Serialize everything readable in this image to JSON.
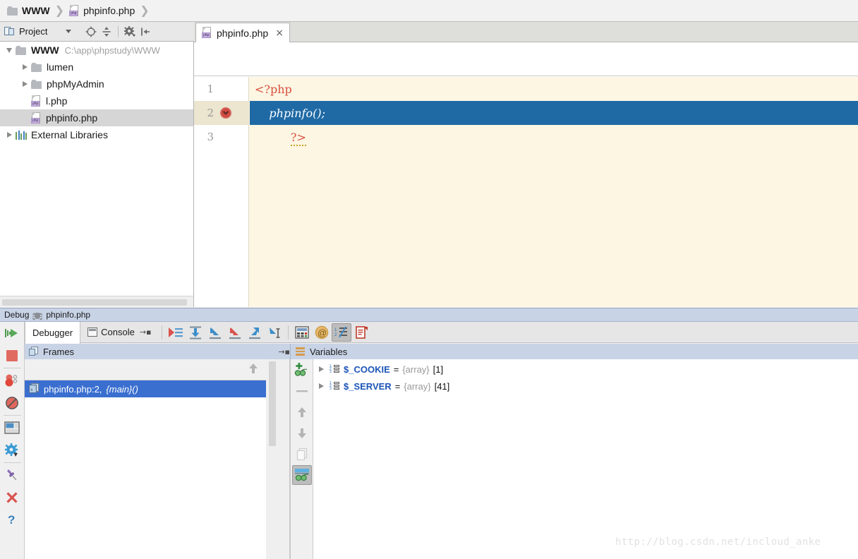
{
  "breadcrumb": {
    "items": [
      {
        "label": "WWW",
        "icon": "folder-icon"
      },
      {
        "label": "phpinfo.php",
        "icon": "php-file-icon"
      }
    ],
    "separator": "❯"
  },
  "project_toolbar": {
    "title": "Project",
    "icons": [
      "locate-target-icon",
      "collapse-all-icon",
      "settings-gear-icon",
      "hide-panel-icon"
    ]
  },
  "editor_tabs": {
    "tabs": [
      {
        "label": "phpinfo.php",
        "icon": "php-file-icon",
        "close": "×",
        "active": true
      }
    ]
  },
  "project_tree": {
    "rows": [
      {
        "label": "WWW",
        "path": "C:\\app\\phpstudy\\WWW",
        "icon": "folder-icon",
        "twisty": "down",
        "bold": true,
        "indent": 0,
        "selected": false
      },
      {
        "label": "lumen",
        "path": "",
        "icon": "folder-icon",
        "twisty": "right",
        "bold": false,
        "indent": 1,
        "selected": false
      },
      {
        "label": "phpMyAdmin",
        "path": "",
        "icon": "folder-icon",
        "twisty": "right",
        "bold": false,
        "indent": 1,
        "selected": false
      },
      {
        "label": "l.php",
        "path": "",
        "icon": "php-file-icon",
        "twisty": "none",
        "bold": false,
        "indent": 1,
        "selected": false
      },
      {
        "label": "phpinfo.php",
        "path": "",
        "icon": "php-file-icon",
        "twisty": "none",
        "bold": false,
        "indent": 1,
        "selected": true
      },
      {
        "label": "External Libraries",
        "path": "",
        "icon": "libraries-icon",
        "twisty": "right",
        "bold": false,
        "indent": 0,
        "selected": false
      }
    ]
  },
  "editor": {
    "language": "php",
    "background_color": "#fcf6e3",
    "current_line_color": "#1f6aa5",
    "lines": [
      {
        "number": "1",
        "text": "<?php",
        "token": "tag",
        "breakpoint": false,
        "current": false
      },
      {
        "number": "2",
        "text": "    phpinfo();",
        "token": "fn",
        "breakpoint": true,
        "current": true
      },
      {
        "number": "3",
        "text": "?>",
        "token": "end",
        "breakpoint": false,
        "current": false
      }
    ]
  },
  "debug": {
    "header_title": "Debug",
    "header_file": "phpinfo.php",
    "header_icon": "bug-icon",
    "left_rail": [
      {
        "name": "resume-program-button",
        "icon": "resume-icon"
      },
      {
        "name": "stop-button",
        "icon": "stop-icon"
      },
      {
        "name": "view-breakpoints-button",
        "icon": "breakpoints-icon"
      },
      {
        "name": "mute-breakpoints-button",
        "icon": "mute-breakpoints-icon"
      },
      {
        "name": "restore-layout-button",
        "icon": "layout-icon"
      },
      {
        "name": "settings-button",
        "icon": "gear-icon"
      },
      {
        "name": "pin-tab-button",
        "icon": "pin-icon"
      },
      {
        "name": "close-button",
        "icon": "close-icon"
      },
      {
        "name": "help-button",
        "icon": "help-icon"
      }
    ],
    "tabs": [
      {
        "label": "Debugger",
        "icon": "",
        "active": true
      },
      {
        "label": "Console",
        "icon": "console-icon",
        "active": false
      }
    ],
    "console_hide_glyph": "→▪",
    "step_buttons": [
      {
        "name": "show-execution-point-button",
        "icon": "show-execution-point-icon",
        "pressed": false
      },
      {
        "name": "step-over-button",
        "icon": "step-over-icon",
        "pressed": false
      },
      {
        "name": "step-into-button",
        "icon": "step-into-icon",
        "pressed": false
      },
      {
        "name": "force-step-into-button",
        "icon": "force-step-into-icon",
        "pressed": false
      },
      {
        "name": "step-out-button",
        "icon": "step-out-icon",
        "pressed": false
      },
      {
        "name": "run-to-cursor-button",
        "icon": "run-to-cursor-icon",
        "pressed": false
      },
      {
        "name": "evaluate-expression-button",
        "icon": "calculator-icon",
        "pressed": false
      },
      {
        "name": "trace-button",
        "icon": "at-sign-icon",
        "pressed": false
      },
      {
        "name": "sort-values-button",
        "icon": "sort-numeric-icon",
        "pressed": true
      },
      {
        "name": "copy-stack-button",
        "icon": "clipboard-icon",
        "pressed": false
      }
    ],
    "frames": {
      "header": "Frames",
      "header_icon": "frames-icon",
      "hide_glyph": "→▪",
      "thread_nav": [
        "up-arrow-icon",
        "down-arrow-icon"
      ],
      "rows": [
        {
          "file_line": "phpinfo.php:2,",
          "function": "{main}()",
          "selected": true
        }
      ]
    },
    "variables": {
      "header": "Variables",
      "header_icon": "variables-icon",
      "rail_buttons": [
        {
          "name": "new-watch-button",
          "icon": "add-watch-icon",
          "pressed": false
        },
        {
          "name": "remove-watch-button",
          "icon": "minus-icon",
          "pressed": false
        },
        {
          "name": "move-up-button",
          "icon": "up-arrow-icon",
          "pressed": false
        },
        {
          "name": "move-down-button",
          "icon": "down-arrow-icon",
          "pressed": false
        },
        {
          "name": "copy-value-button",
          "icon": "copy-icon",
          "pressed": false
        },
        {
          "name": "inspect-button",
          "icon": "glasses-icon",
          "pressed": true
        }
      ],
      "rows": [
        {
          "name": "$_COOKIE",
          "eq": "=",
          "type": "{array}",
          "count": "[1]",
          "icon": "array-icon",
          "expandable": true
        },
        {
          "name": "$_SERVER",
          "eq": "=",
          "type": "{array}",
          "count": "[41]",
          "icon": "array-icon",
          "expandable": true
        }
      ]
    }
  },
  "watermark": "http://blog.csdn.net/incloud_anke",
  "colors": {
    "selection_blue": "#3a6fd0",
    "current_line_blue": "#1f6aa5",
    "panel_header_blue": "#c8d3e6",
    "editor_cream": "#fcf6e3",
    "tree_selection_grey": "#d6d6d6",
    "php_tag_red": "#d94f3d",
    "variable_name_blue": "#1b54b8"
  }
}
